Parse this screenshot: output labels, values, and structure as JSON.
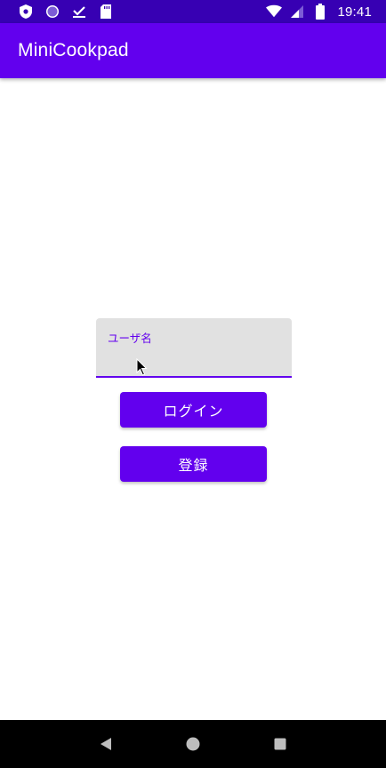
{
  "status_bar": {
    "time": "19:41",
    "left_icons": [
      "shield-icon",
      "circle-icon",
      "download-done-icon",
      "sd-card-icon"
    ],
    "right_icons": [
      "wifi-icon",
      "signal-icon",
      "battery-icon"
    ]
  },
  "app_bar": {
    "title": "MiniCookpad"
  },
  "login_form": {
    "username_label": "ユーザ名",
    "username_value": "",
    "login_button": "ログイン",
    "register_button": "登録"
  },
  "nav_bar": {
    "icons": [
      "back-icon",
      "home-icon",
      "recents-icon"
    ]
  },
  "colors": {
    "status_bar": "#3700b3",
    "primary": "#6200ee",
    "field_bg": "#e1e1e1",
    "nav_bar": "#000000"
  }
}
